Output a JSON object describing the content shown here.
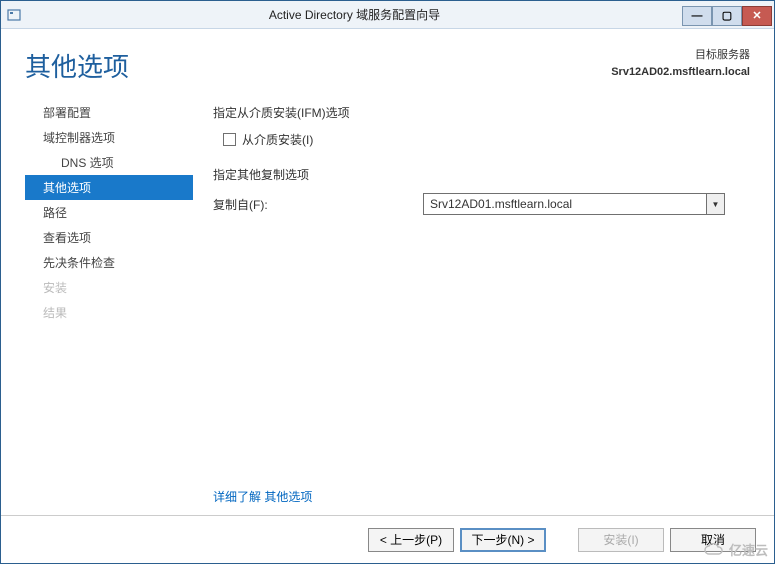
{
  "window": {
    "title": "Active Directory 域服务配置向导"
  },
  "header": {
    "page_title": "其他选项",
    "target_label": "目标服务器",
    "target_server": "Srv12AD02.msftlearn.local"
  },
  "sidebar": {
    "items": [
      {
        "label": "部署配置",
        "state": "normal"
      },
      {
        "label": "域控制器选项",
        "state": "normal"
      },
      {
        "label": "DNS 选项",
        "state": "sub"
      },
      {
        "label": "其他选项",
        "state": "selected"
      },
      {
        "label": "路径",
        "state": "normal"
      },
      {
        "label": "查看选项",
        "state": "normal"
      },
      {
        "label": "先决条件检查",
        "state": "normal"
      },
      {
        "label": "安装",
        "state": "disabled"
      },
      {
        "label": "结果",
        "state": "disabled"
      }
    ]
  },
  "main": {
    "ifm_section_label": "指定从介质安装(IFM)选项",
    "ifm_checkbox_label": "从介质安装(I)",
    "ifm_checked": false,
    "repl_section_label": "指定其他复制选项",
    "replicate_from_label": "复制自(F):",
    "replicate_from_value": "Srv12AD01.msftlearn.local",
    "more_link_prefix": "详细了解",
    "more_link_topic": "其他选项"
  },
  "footer": {
    "prev": "< 上一步(P)",
    "next": "下一步(N) >",
    "install": "安装(I)",
    "cancel": "取消"
  },
  "watermark": "亿速云"
}
